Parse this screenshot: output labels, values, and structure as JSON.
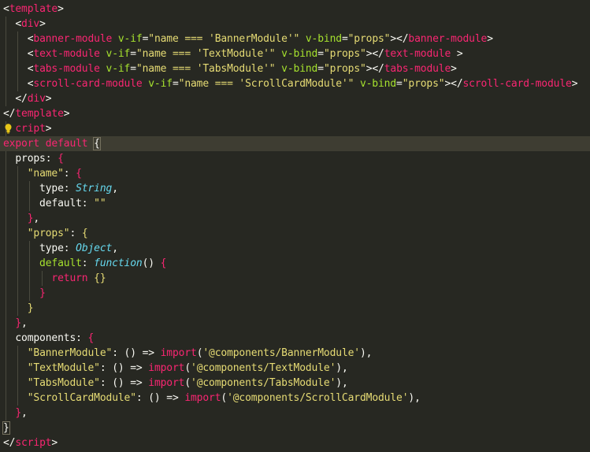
{
  "editor": {
    "lines": [
      [
        {
          "t": "<",
          "c": "punct"
        },
        {
          "t": "template",
          "c": "tag"
        },
        {
          "t": ">",
          "c": "punct"
        }
      ],
      [
        {
          "t": "  <",
          "c": "punct"
        },
        {
          "t": "div",
          "c": "tag"
        },
        {
          "t": ">",
          "c": "punct"
        }
      ],
      [
        {
          "t": "    <",
          "c": "punct"
        },
        {
          "t": "banner-module",
          "c": "tag"
        },
        {
          "t": " v-if",
          "c": "attr"
        },
        {
          "t": "=",
          "c": "punct"
        },
        {
          "t": "\"name === 'BannerModule'\"",
          "c": "str"
        },
        {
          "t": " v-bind",
          "c": "attr"
        },
        {
          "t": "=",
          "c": "punct"
        },
        {
          "t": "\"props\"",
          "c": "str"
        },
        {
          "t": "></",
          "c": "punct"
        },
        {
          "t": "banner-module",
          "c": "tag"
        },
        {
          "t": ">",
          "c": "punct"
        }
      ],
      [
        {
          "t": "    <",
          "c": "punct"
        },
        {
          "t": "text-module",
          "c": "tag"
        },
        {
          "t": " v-if",
          "c": "attr"
        },
        {
          "t": "=",
          "c": "punct"
        },
        {
          "t": "\"name === 'TextModule'\"",
          "c": "str"
        },
        {
          "t": " v-bind",
          "c": "attr"
        },
        {
          "t": "=",
          "c": "punct"
        },
        {
          "t": "\"props\"",
          "c": "str"
        },
        {
          "t": "></",
          "c": "punct"
        },
        {
          "t": "text-module",
          "c": "tag"
        },
        {
          "t": " >",
          "c": "punct"
        }
      ],
      [
        {
          "t": "    <",
          "c": "punct"
        },
        {
          "t": "tabs-module",
          "c": "tag"
        },
        {
          "t": " v-if",
          "c": "attr"
        },
        {
          "t": "=",
          "c": "punct"
        },
        {
          "t": "\"name === 'TabsModule'\"",
          "c": "str"
        },
        {
          "t": " v-bind",
          "c": "attr"
        },
        {
          "t": "=",
          "c": "punct"
        },
        {
          "t": "\"props\"",
          "c": "str"
        },
        {
          "t": "></",
          "c": "punct"
        },
        {
          "t": "tabs-module",
          "c": "tag"
        },
        {
          "t": ">",
          "c": "punct"
        }
      ],
      [
        {
          "t": "    <",
          "c": "punct"
        },
        {
          "t": "scroll-card-module",
          "c": "tag"
        },
        {
          "t": " v-if",
          "c": "attr"
        },
        {
          "t": "=",
          "c": "punct"
        },
        {
          "t": "\"name === 'ScrollCardModule'\"",
          "c": "str"
        },
        {
          "t": " v-bind",
          "c": "attr"
        },
        {
          "t": "=",
          "c": "punct"
        },
        {
          "t": "\"props\"",
          "c": "str"
        },
        {
          "t": "></",
          "c": "punct"
        },
        {
          "t": "scroll-card-module",
          "c": "tag"
        },
        {
          "t": ">",
          "c": "punct"
        }
      ],
      [
        {
          "t": "  </",
          "c": "punct"
        },
        {
          "t": "div",
          "c": "tag"
        },
        {
          "t": ">",
          "c": "punct"
        }
      ],
      [
        {
          "t": "</",
          "c": "punct"
        },
        {
          "t": "template",
          "c": "tag"
        },
        {
          "t": ">",
          "c": "punct"
        }
      ],
      [
        {
          "t": "  ",
          "c": "punct"
        },
        {
          "t": "cript",
          "c": "tag"
        },
        {
          "t": ">",
          "c": "punct"
        }
      ],
      [
        {
          "t": "export default ",
          "c": "kw"
        },
        {
          "t": "{",
          "c": "brace-hl"
        }
      ],
      [
        {
          "t": "  props",
          "c": "prop"
        },
        {
          "t": ": ",
          "c": "punct"
        },
        {
          "t": "{",
          "c": "kw"
        }
      ],
      [
        {
          "t": "    ",
          "c": "punct"
        },
        {
          "t": "\"name\"",
          "c": "str"
        },
        {
          "t": ": ",
          "c": "punct"
        },
        {
          "t": "{",
          "c": "kw"
        }
      ],
      [
        {
          "t": "      type",
          "c": "prop"
        },
        {
          "t": ": ",
          "c": "punct"
        },
        {
          "t": "String",
          "c": "type"
        },
        {
          "t": ",",
          "c": "punct"
        }
      ],
      [
        {
          "t": "      default",
          "c": "prop"
        },
        {
          "t": ": ",
          "c": "punct"
        },
        {
          "t": "\"\"",
          "c": "str"
        }
      ],
      [
        {
          "t": "    ",
          "c": "punct"
        },
        {
          "t": "}",
          "c": "kw"
        },
        {
          "t": ",",
          "c": "punct"
        }
      ],
      [
        {
          "t": "    ",
          "c": "punct"
        },
        {
          "t": "\"props\"",
          "c": "str"
        },
        {
          "t": ": ",
          "c": "punct"
        },
        {
          "t": "{",
          "c": "yellow"
        }
      ],
      [
        {
          "t": "      type",
          "c": "prop"
        },
        {
          "t": ": ",
          "c": "punct"
        },
        {
          "t": "Object",
          "c": "type"
        },
        {
          "t": ",",
          "c": "punct"
        }
      ],
      [
        {
          "t": "      default",
          "c": "attr"
        },
        {
          "t": ": ",
          "c": "punct"
        },
        {
          "t": "function",
          "c": "fn"
        },
        {
          "t": "() ",
          "c": "punct"
        },
        {
          "t": "{",
          "c": "kw"
        }
      ],
      [
        {
          "t": "        ",
          "c": "punct"
        },
        {
          "t": "return ",
          "c": "kw"
        },
        {
          "t": "{}",
          "c": "yellow"
        }
      ],
      [
        {
          "t": "      ",
          "c": "punct"
        },
        {
          "t": "}",
          "c": "kw"
        }
      ],
      [
        {
          "t": "    ",
          "c": "punct"
        },
        {
          "t": "}",
          "c": "yellow"
        }
      ],
      [
        {
          "t": "  ",
          "c": "punct"
        },
        {
          "t": "}",
          "c": "kw"
        },
        {
          "t": ",",
          "c": "punct"
        }
      ],
      [
        {
          "t": "  components",
          "c": "prop"
        },
        {
          "t": ": ",
          "c": "punct"
        },
        {
          "t": "{",
          "c": "kw"
        }
      ],
      [
        {
          "t": "    ",
          "c": "punct"
        },
        {
          "t": "\"BannerModule\"",
          "c": "str"
        },
        {
          "t": ": () => ",
          "c": "punct"
        },
        {
          "t": "import",
          "c": "kw"
        },
        {
          "t": "(",
          "c": "punct"
        },
        {
          "t": "'@components/BannerModule'",
          "c": "str"
        },
        {
          "t": "),",
          "c": "punct"
        }
      ],
      [
        {
          "t": "    ",
          "c": "punct"
        },
        {
          "t": "\"TextModule\"",
          "c": "str"
        },
        {
          "t": ": () => ",
          "c": "punct"
        },
        {
          "t": "import",
          "c": "kw"
        },
        {
          "t": "(",
          "c": "punct"
        },
        {
          "t": "'@components/TextModule'",
          "c": "str"
        },
        {
          "t": "),",
          "c": "punct"
        }
      ],
      [
        {
          "t": "    ",
          "c": "punct"
        },
        {
          "t": "\"TabsModule\"",
          "c": "str"
        },
        {
          "t": ": () => ",
          "c": "punct"
        },
        {
          "t": "import",
          "c": "kw"
        },
        {
          "t": "(",
          "c": "punct"
        },
        {
          "t": "'@components/TabsModule'",
          "c": "str"
        },
        {
          "t": "),",
          "c": "punct"
        }
      ],
      [
        {
          "t": "    ",
          "c": "punct"
        },
        {
          "t": "\"ScrollCardModule\"",
          "c": "str"
        },
        {
          "t": ": () => ",
          "c": "punct"
        },
        {
          "t": "import",
          "c": "kw"
        },
        {
          "t": "(",
          "c": "punct"
        },
        {
          "t": "'@components/ScrollCardModule'",
          "c": "str"
        },
        {
          "t": "),",
          "c": "punct"
        }
      ],
      [
        {
          "t": "  ",
          "c": "punct"
        },
        {
          "t": "}",
          "c": "kw"
        },
        {
          "t": ",",
          "c": "punct"
        }
      ],
      [
        {
          "t": "}",
          "c": "brace-hl"
        }
      ],
      [
        {
          "t": "</",
          "c": "punct"
        },
        {
          "t": "script",
          "c": "tag"
        },
        {
          "t": ">",
          "c": "punct"
        }
      ]
    ],
    "current_line": 9,
    "icons": {
      "lightbulb": "lightbulb-icon"
    },
    "colors": {
      "background": "#272822",
      "tag": "#f92672",
      "attribute": "#a6e22e",
      "string": "#e6db74",
      "type": "#66d9ef"
    }
  }
}
